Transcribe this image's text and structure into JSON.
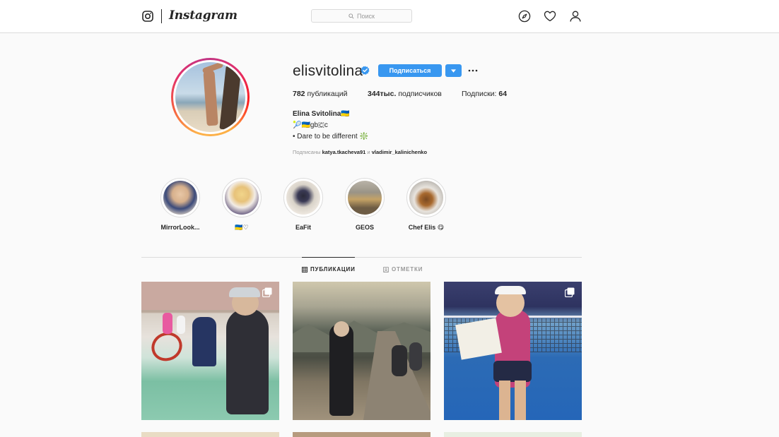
{
  "header": {
    "brand": "Instagram",
    "search_placeholder": "Поиск",
    "icons": [
      "instagram-camera-icon",
      "search-icon",
      "explore-compass-icon",
      "heart-icon",
      "profile-icon"
    ]
  },
  "profile": {
    "username": "elisvitolina",
    "verified": true,
    "follow_label": "Подписаться",
    "stats": {
      "posts_count": "782",
      "posts_label": "публикаций",
      "followers_count": "344тыс.",
      "followers_label": "подписчиков",
      "following_label": "Подписки:",
      "following_count": "64"
    },
    "bio": {
      "name": "Elina Svitolina🇺🇦",
      "line1": "🎾🇺🇦gb🇨c",
      "line2": "• Dare to be different ❇️"
    },
    "followed_by": {
      "prefix": "Подписаны",
      "user1": "katya.tkacheva91",
      "connector": "и",
      "user2": "vladimir_kalinichenko"
    }
  },
  "highlights": [
    {
      "label": "MirrorLook..."
    },
    {
      "label": "🇺🇦♡"
    },
    {
      "label": "EaFit"
    },
    {
      "label": "GEOS"
    },
    {
      "label": "Chef Elis 😋"
    }
  ],
  "tabs": [
    {
      "label": "ПУБЛИКАЦИИ",
      "active": true
    },
    {
      "label": "ОТМЕТКИ",
      "active": false
    }
  ],
  "colors": {
    "accent": "#3897f0",
    "ring_gradient": [
      "#fdb14a",
      "#e1306c",
      "#c13584"
    ],
    "background": "#fafafa",
    "border": "#dbdbdb"
  }
}
